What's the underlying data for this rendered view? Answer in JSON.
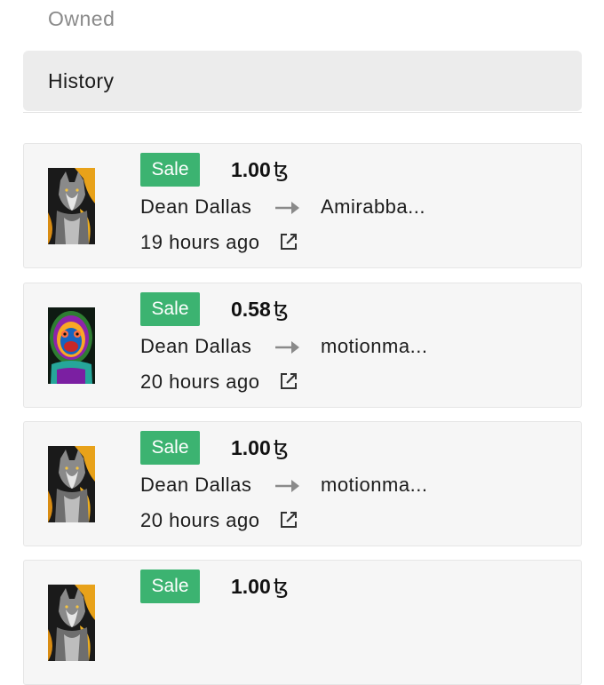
{
  "tabs": {
    "owned_label": "Owned",
    "history_label": "History"
  },
  "colors": {
    "sale_badge": "#3cb371",
    "active_tab_bg": "#ececec",
    "card_bg": "#f6f6f6"
  },
  "currency_symbol": "ꜩ",
  "history": [
    {
      "type": "Sale",
      "price": "1.00",
      "from": "Dean Dallas",
      "to": "Amirabba...",
      "time": "19 hours ago",
      "thumbnail": "wolf-artwork",
      "link_icon": "external-link-icon"
    },
    {
      "type": "Sale",
      "price": "0.58",
      "from": "Dean Dallas",
      "to": "motionma...",
      "time": "20 hours ago",
      "thumbnail": "psychedelic-ape-artwork",
      "link_icon": "external-link-icon"
    },
    {
      "type": "Sale",
      "price": "1.00",
      "from": "Dean Dallas",
      "to": "motionma...",
      "time": "20 hours ago",
      "thumbnail": "wolf-artwork",
      "link_icon": "external-link-icon"
    },
    {
      "type": "Sale",
      "price": "1.00",
      "from": "",
      "to": "",
      "time": "",
      "thumbnail": "wolf-artwork",
      "link_icon": "external-link-icon"
    }
  ]
}
